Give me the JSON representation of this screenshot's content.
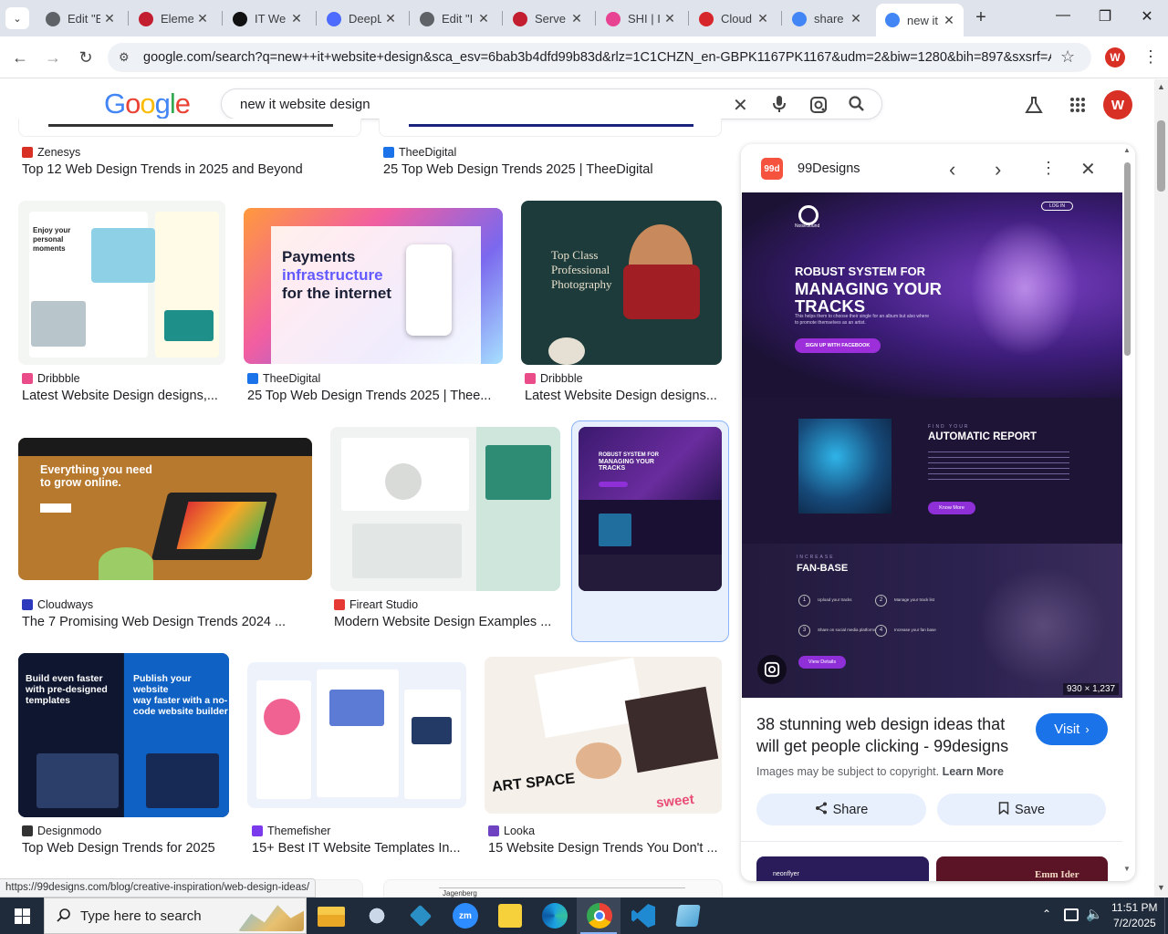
{
  "browser": {
    "tabs": [
      {
        "title": "Edit \"E",
        "favicon": "globe-icon",
        "color": "#5f6368"
      },
      {
        "title": "Eleme",
        "favicon": "elementor-icon",
        "color": "#c21e2f"
      },
      {
        "title": "IT We",
        "favicon": "circle-logo-icon",
        "color": "#111111"
      },
      {
        "title": "DeepL",
        "favicon": "deepseek-icon",
        "color": "#4d6bfe"
      },
      {
        "title": "Edit \"I",
        "favicon": "globe-icon",
        "color": "#5f6368"
      },
      {
        "title": "Serve",
        "favicon": "elementor-icon",
        "color": "#c21e2f"
      },
      {
        "title": "SHI | I",
        "favicon": "ring-icon",
        "color": "#e84393"
      },
      {
        "title": "Cloud",
        "favicon": "claude-icon",
        "color": "#d7262b"
      },
      {
        "title": "share",
        "favicon": "google-icon",
        "color": "#4285f4"
      },
      {
        "title": "new it",
        "favicon": "google-icon",
        "color": "#4285f4",
        "active": true
      }
    ],
    "url": "google.com/search?q=new++it+website+design&sca_esv=6bab3b4dfd99b83d&rlz=1C1CHZN_en-GBPK1167PK1167&udm=2&biw=1280&bih=897&sxsrf=AE...",
    "profile_initial": "W"
  },
  "google": {
    "logo": "Google",
    "query": "new it website design",
    "avatar": "W"
  },
  "results": [
    {
      "source": "Zenesys",
      "title": "Top 12 Web Design Trends in 2025 and Beyond",
      "color": "#d93025"
    },
    {
      "source": "TheeDigital",
      "title": "25 Top Web Design Trends 2025 | TheeDigital",
      "color": "#1a73e8"
    },
    {
      "source": "Dribbble",
      "title": "Latest Website Design designs,...",
      "color": "#ea4c89"
    },
    {
      "source": "TheeDigital",
      "title": "25 Top Web Design Trends 2025 | Thee...",
      "color": "#1a73e8"
    },
    {
      "source": "Dribbble",
      "title": "Latest Website Design designs...",
      "color": "#ea4c89"
    },
    {
      "source": "Cloudways",
      "title": "The 7 Promising Web Design Trends 2024 ...",
      "color": "#2c39bd"
    },
    {
      "source": "Fireart Studio",
      "title": "Modern Website Design Examples ...",
      "color": "#e53935"
    },
    {
      "source": "99Designs",
      "title": "38 stunning web des...",
      "color": "#f5533d"
    },
    {
      "source": "Designmodo",
      "title": "Top Web Design Trends for 2025",
      "color": "#333333"
    },
    {
      "source": "Themefisher",
      "title": "15+ Best IT Website Templates In...",
      "color": "#7c3aed"
    },
    {
      "source": "Looka",
      "title": "15 Website Design Trends You Don't ...",
      "color": "#6f42c1"
    }
  ],
  "thumbs": {
    "t1": {
      "line1": "Enjoy your",
      "line2": "personal",
      "line3": "moments"
    },
    "t2": {
      "line1": "Payments",
      "line2": "infrastructure",
      "line3": "for the internet"
    },
    "t3": {
      "line1": "Top Class",
      "line2": "Professional",
      "line3": "Photography"
    },
    "t4": {
      "line1": "Everything you need",
      "line2": "to grow online."
    },
    "t6": {
      "line1": "ROBUST SYSTEM FOR",
      "line2": "MANAGING YOUR",
      "line3": "TRACKS"
    },
    "t7": {
      "line1": "Build even faster",
      "line2": "with pre-designed",
      "line3": "templates",
      "r1": "Publish your website",
      "r2": "way faster with a no-",
      "r3": "code website builder"
    },
    "t9": {
      "line1": "ART SPACE",
      "line2": "sweet"
    }
  },
  "panel": {
    "site": "99Designs",
    "logo": "99d",
    "hero": {
      "brand": "NoiseSound",
      "login": "LOG IN",
      "h1": "ROBUST SYSTEM FOR",
      "h2": "MANAGING YOUR",
      "h3": "TRACKS",
      "sub": "This helps them to choose their single for an album but also where to promote themselves as an artist.",
      "cta": "SIGN UP WITH FACEBOOK",
      "find": "FIND YOUR",
      "report_title": "AUTOMATIC REPORT",
      "report_btn": "Know More",
      "increase": "INCREASE",
      "fan_title": "FAN-BASE",
      "steps": [
        "Upload your tracks",
        "Manage your track list",
        "Share on social media platforms",
        "Increase your fan base"
      ],
      "details_btn": "View Details"
    },
    "dimensions": "930 × 1,237",
    "title": "38 stunning web design ideas that will get people clicking - 99designs",
    "visit": "Visit",
    "copyright": "Images may be subject to copyright.",
    "learn_more": "Learn More",
    "share": "Share",
    "save": "Save",
    "below_brand": "neonflyer",
    "below_text": "Emm Ider"
  },
  "status_url": "https://99designs.com/blog/creative-inspiration/web-design-ideas/",
  "bottom_peek": "Jagenberg",
  "taskbar": {
    "search_placeholder": "Type here to search",
    "time": "11:51 PM",
    "date": "7/2/2025"
  }
}
